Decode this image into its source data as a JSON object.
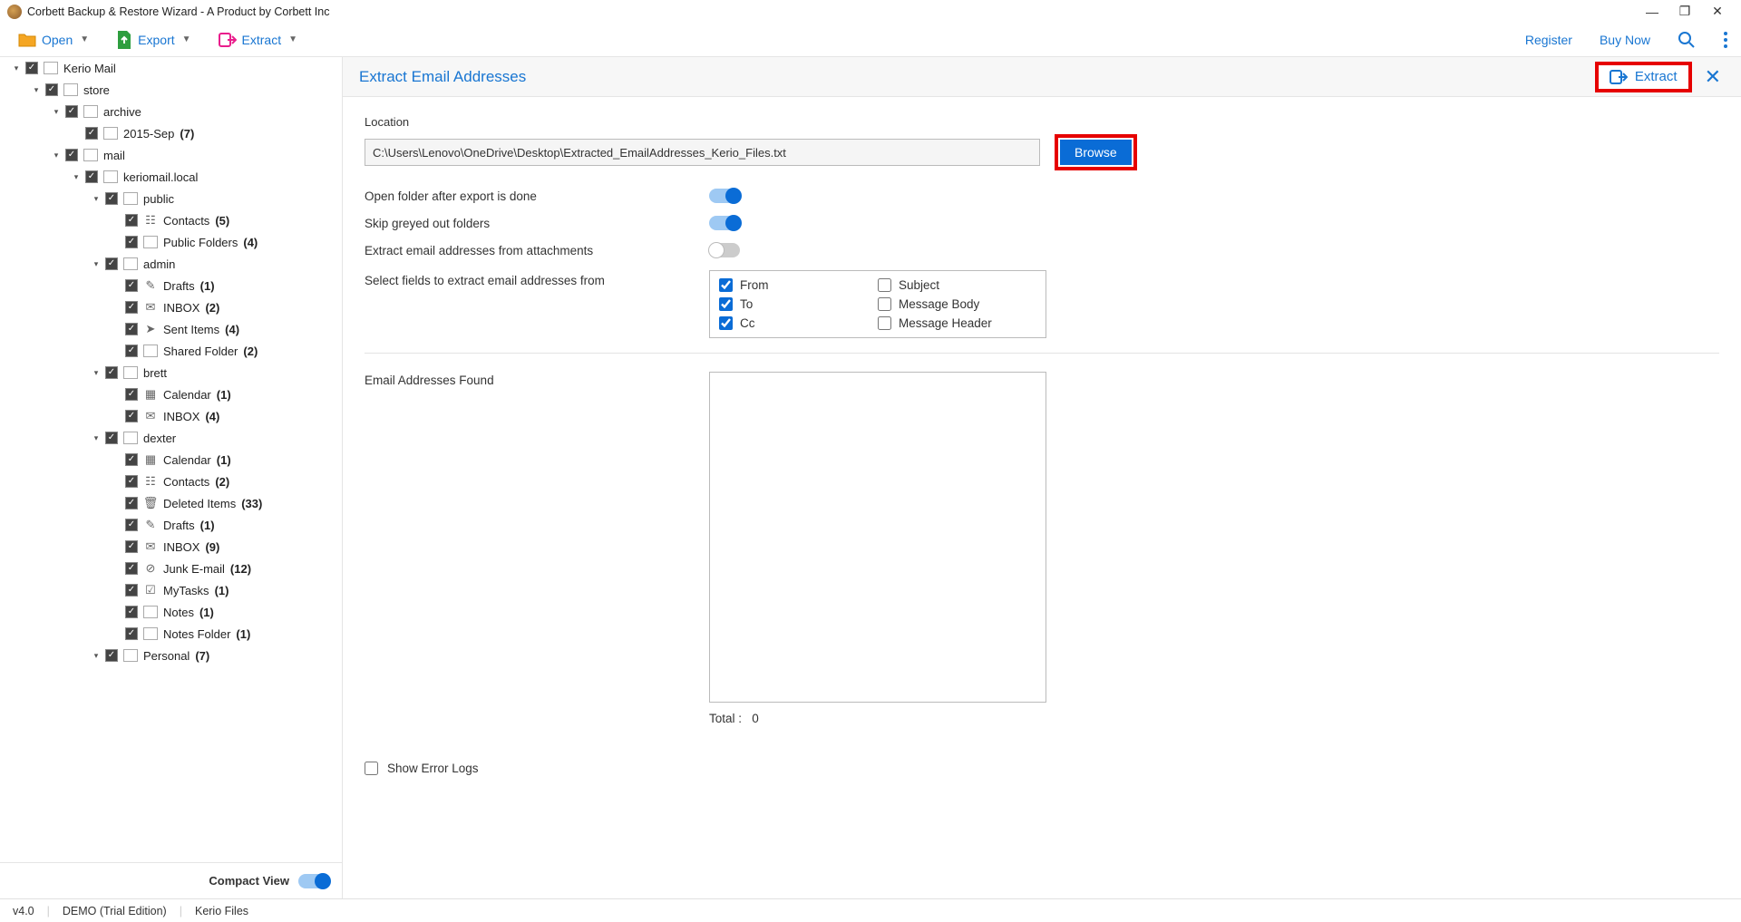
{
  "window": {
    "title": "Corbett Backup & Restore Wizard - A Product by Corbett Inc"
  },
  "toolbar": {
    "open": "Open",
    "export": "Export",
    "extract": "Extract",
    "register": "Register",
    "buy": "Buy Now"
  },
  "tree": [
    {
      "depth": 0,
      "arrow": "▾",
      "icon": "folder",
      "label": "Kerio Mail",
      "count": ""
    },
    {
      "depth": 1,
      "arrow": "▾",
      "icon": "folder",
      "label": "store",
      "count": ""
    },
    {
      "depth": 2,
      "arrow": "▾",
      "icon": "folder",
      "label": "archive",
      "count": ""
    },
    {
      "depth": 3,
      "arrow": "",
      "icon": "folder",
      "label": "2015-Sep",
      "count": "(7)"
    },
    {
      "depth": 2,
      "arrow": "▾",
      "icon": "folder",
      "label": "mail",
      "count": ""
    },
    {
      "depth": 3,
      "arrow": "▾",
      "icon": "folder",
      "label": "keriomail.local",
      "count": ""
    },
    {
      "depth": 4,
      "arrow": "▾",
      "icon": "folder",
      "label": "public",
      "count": ""
    },
    {
      "depth": 5,
      "arrow": "",
      "icon": "contacts",
      "label": "Contacts",
      "count": "(5)"
    },
    {
      "depth": 5,
      "arrow": "",
      "icon": "folder",
      "label": "Public Folders",
      "count": "(4)"
    },
    {
      "depth": 4,
      "arrow": "▾",
      "icon": "folder",
      "label": "admin",
      "count": ""
    },
    {
      "depth": 5,
      "arrow": "",
      "icon": "drafts",
      "label": "Drafts",
      "count": "(1)"
    },
    {
      "depth": 5,
      "arrow": "",
      "icon": "mail",
      "label": "INBOX",
      "count": "(2)"
    },
    {
      "depth": 5,
      "arrow": "",
      "icon": "sent",
      "label": "Sent Items",
      "count": "(4)"
    },
    {
      "depth": 5,
      "arrow": "",
      "icon": "folder",
      "label": "Shared Folder",
      "count": "(2)"
    },
    {
      "depth": 4,
      "arrow": "▾",
      "icon": "folder",
      "label": "brett",
      "count": ""
    },
    {
      "depth": 5,
      "arrow": "",
      "icon": "calendar",
      "label": "Calendar",
      "count": "(1)"
    },
    {
      "depth": 5,
      "arrow": "",
      "icon": "mail",
      "label": "INBOX",
      "count": "(4)"
    },
    {
      "depth": 4,
      "arrow": "▾",
      "icon": "folder",
      "label": "dexter",
      "count": ""
    },
    {
      "depth": 5,
      "arrow": "",
      "icon": "calendar",
      "label": "Calendar",
      "count": "(1)"
    },
    {
      "depth": 5,
      "arrow": "",
      "icon": "contacts",
      "label": "Contacts",
      "count": "(2)"
    },
    {
      "depth": 5,
      "arrow": "",
      "icon": "trash",
      "label": "Deleted Items",
      "count": "(33)"
    },
    {
      "depth": 5,
      "arrow": "",
      "icon": "drafts",
      "label": "Drafts",
      "count": "(1)"
    },
    {
      "depth": 5,
      "arrow": "",
      "icon": "mail",
      "label": "INBOX",
      "count": "(9)"
    },
    {
      "depth": 5,
      "arrow": "",
      "icon": "junk",
      "label": "Junk E-mail",
      "count": "(12)"
    },
    {
      "depth": 5,
      "arrow": "",
      "icon": "tasks",
      "label": "MyTasks",
      "count": "(1)"
    },
    {
      "depth": 5,
      "arrow": "",
      "icon": "folder",
      "label": "Notes",
      "count": "(1)"
    },
    {
      "depth": 5,
      "arrow": "",
      "icon": "folder",
      "label": "Notes Folder",
      "count": "(1)"
    },
    {
      "depth": 4,
      "arrow": "▾",
      "icon": "folder",
      "label": "Personal",
      "count": "(7)"
    }
  ],
  "compact": {
    "label": "Compact View",
    "on": true
  },
  "panel": {
    "title": "Extract Email Addresses",
    "extract_btn": "Extract",
    "location_label": "Location",
    "location_value": "C:\\Users\\Lenovo\\OneDrive\\Desktop\\Extracted_EmailAddresses_Kerio_Files.txt",
    "browse": "Browse",
    "opt_open_folder": "Open folder after export is done",
    "opt_skip_grey": "Skip greyed out folders",
    "opt_attach": "Extract email addresses from attachments",
    "toggle_open_folder": true,
    "toggle_skip_grey": true,
    "toggle_attach": false,
    "fields_label": "Select fields to extract email addresses from",
    "fields": {
      "from": {
        "label": "From",
        "checked": true
      },
      "to": {
        "label": "To",
        "checked": true
      },
      "cc": {
        "label": "Cc",
        "checked": true
      },
      "subject": {
        "label": "Subject",
        "checked": false
      },
      "body": {
        "label": "Message Body",
        "checked": false
      },
      "header": {
        "label": "Message Header",
        "checked": false
      }
    },
    "found_label": "Email Addresses Found",
    "total_label": "Total :",
    "total_value": "0",
    "error_logs": "Show Error Logs"
  },
  "status": {
    "version": "v4.0",
    "edition": "DEMO (Trial Edition)",
    "file": "Kerio Files"
  }
}
